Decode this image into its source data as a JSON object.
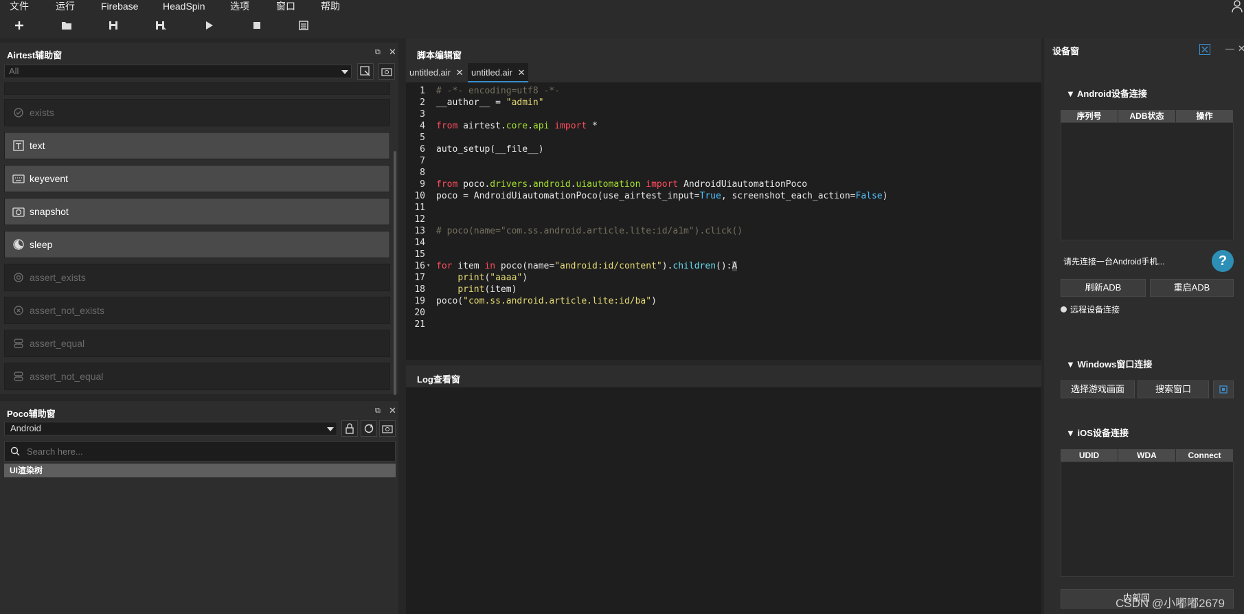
{
  "menu": {
    "items": [
      "文件",
      "运行",
      "Firebase",
      "HeadSpin",
      "选项",
      "窗口",
      "帮助"
    ]
  },
  "toolbar": {
    "icons": [
      "add-icon",
      "open-folder-icon",
      "save-icon",
      "save-as-icon",
      "run-icon",
      "stop-icon",
      "list-icon"
    ]
  },
  "airtest": {
    "title": "Airtest辅助窗",
    "filter_value": "All",
    "commands": [
      {
        "label": "exists",
        "icon": "exists-icon",
        "enabled": false
      },
      {
        "label": "text",
        "icon": "text-icon",
        "enabled": true
      },
      {
        "label": "keyevent",
        "icon": "keyboard-icon",
        "enabled": true
      },
      {
        "label": "snapshot",
        "icon": "camera-icon",
        "enabled": true
      },
      {
        "label": "sleep",
        "icon": "moon-icon",
        "enabled": true
      },
      {
        "label": "assert_exists",
        "icon": "target-icon",
        "enabled": false
      },
      {
        "label": "assert_not_exists",
        "icon": "target-x-icon",
        "enabled": false
      },
      {
        "label": "assert_equal",
        "icon": "equal-icon",
        "enabled": false
      },
      {
        "label": "assert_not_equal",
        "icon": "not-equal-icon",
        "enabled": false
      }
    ]
  },
  "poco": {
    "title": "Poco辅助窗",
    "mode": "Android",
    "search_placeholder": "Search here...",
    "tree_header": "UI渲染树"
  },
  "editor": {
    "title": "脚本编辑窗",
    "tabs": [
      {
        "label": "untitled.air",
        "active": false
      },
      {
        "label": "untitled.air",
        "active": true
      }
    ],
    "lines": [
      "1",
      "2",
      "3",
      "4",
      "5",
      "6",
      "7",
      "8",
      "9",
      "10",
      "11",
      "12",
      "13",
      "14",
      "15",
      "16",
      "17",
      "18",
      "19",
      "20",
      "21"
    ]
  },
  "log": {
    "title": "Log查看窗"
  },
  "device": {
    "title": "设备窗",
    "android": {
      "title": "Android设备连接",
      "columns": [
        "序列号",
        "ADB状态",
        "操作"
      ],
      "hint": "请先连接一台Android手机...",
      "refresh_label": "刷新ADB",
      "restart_label": "重启ADB",
      "remote_label": "远程设备连接"
    },
    "windows": {
      "title": "Windows窗口连接",
      "select_label": "选择游戏画面",
      "search_label": "搜索窗口"
    },
    "ios": {
      "title": "iOS设备连接",
      "columns": [
        "UDID",
        "WDA",
        "Connect"
      ]
    },
    "bottom_button": "内部回",
    "watermark": "CSDN @小嘟嘟2679"
  },
  "colors": {
    "accent": "#3b8ed0",
    "keyword": "#ff4d5c",
    "string": "#e6db74",
    "module": "#a6e22e",
    "comment": "#75715e"
  }
}
